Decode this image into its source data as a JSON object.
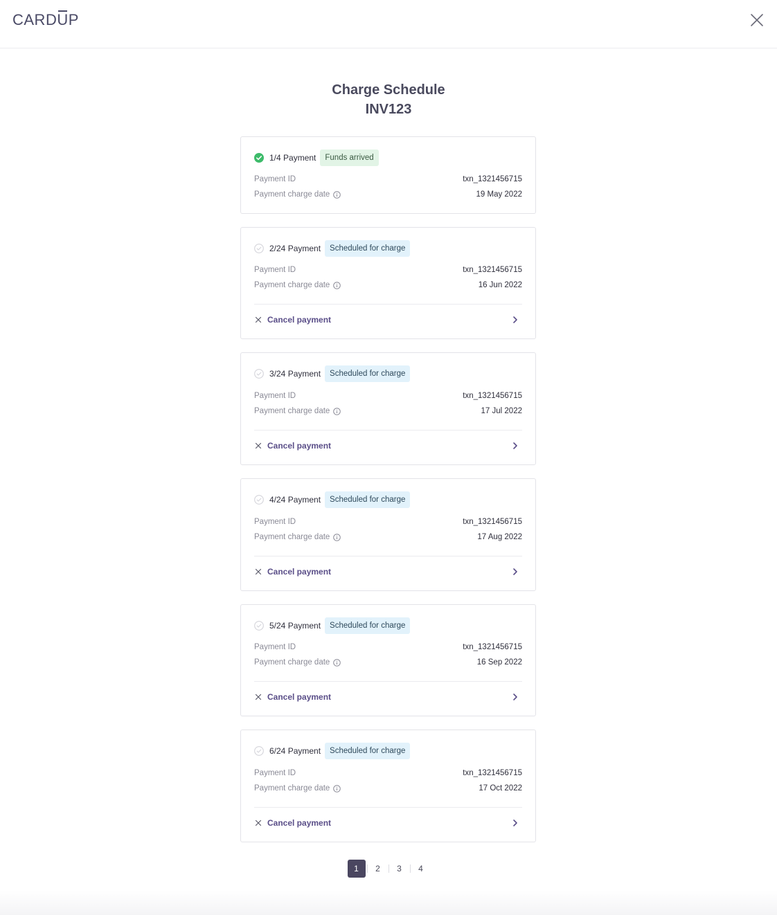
{
  "brand": {
    "logo_pre": "CARD",
    "logo_u": "U",
    "logo_post": "P"
  },
  "header": {
    "title": "Charge Schedule",
    "subtitle": "INV123"
  },
  "labels": {
    "payment_id": "Payment ID",
    "charge_date": "Payment charge date",
    "cancel": "Cancel payment"
  },
  "payments": [
    {
      "label": "1/4 Payment",
      "status": "Funds arrived",
      "status_kind": "arrived",
      "payment_id": "txn_1321456715",
      "charge_date": "19 May 2022",
      "cancellable": false
    },
    {
      "label": "2/24 Payment",
      "status": "Scheduled for charge",
      "status_kind": "scheduled",
      "payment_id": "txn_1321456715",
      "charge_date": "16 Jun 2022",
      "cancellable": true
    },
    {
      "label": "3/24 Payment",
      "status": "Scheduled for charge",
      "status_kind": "scheduled",
      "payment_id": "txn_1321456715",
      "charge_date": "17 Jul 2022",
      "cancellable": true
    },
    {
      "label": "4/24 Payment",
      "status": "Scheduled for charge",
      "status_kind": "scheduled",
      "payment_id": "txn_1321456715",
      "charge_date": "17 Aug 2022",
      "cancellable": true
    },
    {
      "label": "5/24 Payment",
      "status": "Scheduled for charge",
      "status_kind": "scheduled",
      "payment_id": "txn_1321456715",
      "charge_date": "16 Sep 2022",
      "cancellable": true
    },
    {
      "label": "6/24 Payment",
      "status": "Scheduled for charge",
      "status_kind": "scheduled",
      "payment_id": "txn_1321456715",
      "charge_date": "17 Oct 2022",
      "cancellable": true
    }
  ],
  "pagination": {
    "pages": [
      "1",
      "2",
      "3",
      "4"
    ],
    "current": "1"
  },
  "colors": {
    "success": "#3dbb6a",
    "accent": "#5a4e88",
    "active_page": "#4a4660"
  }
}
